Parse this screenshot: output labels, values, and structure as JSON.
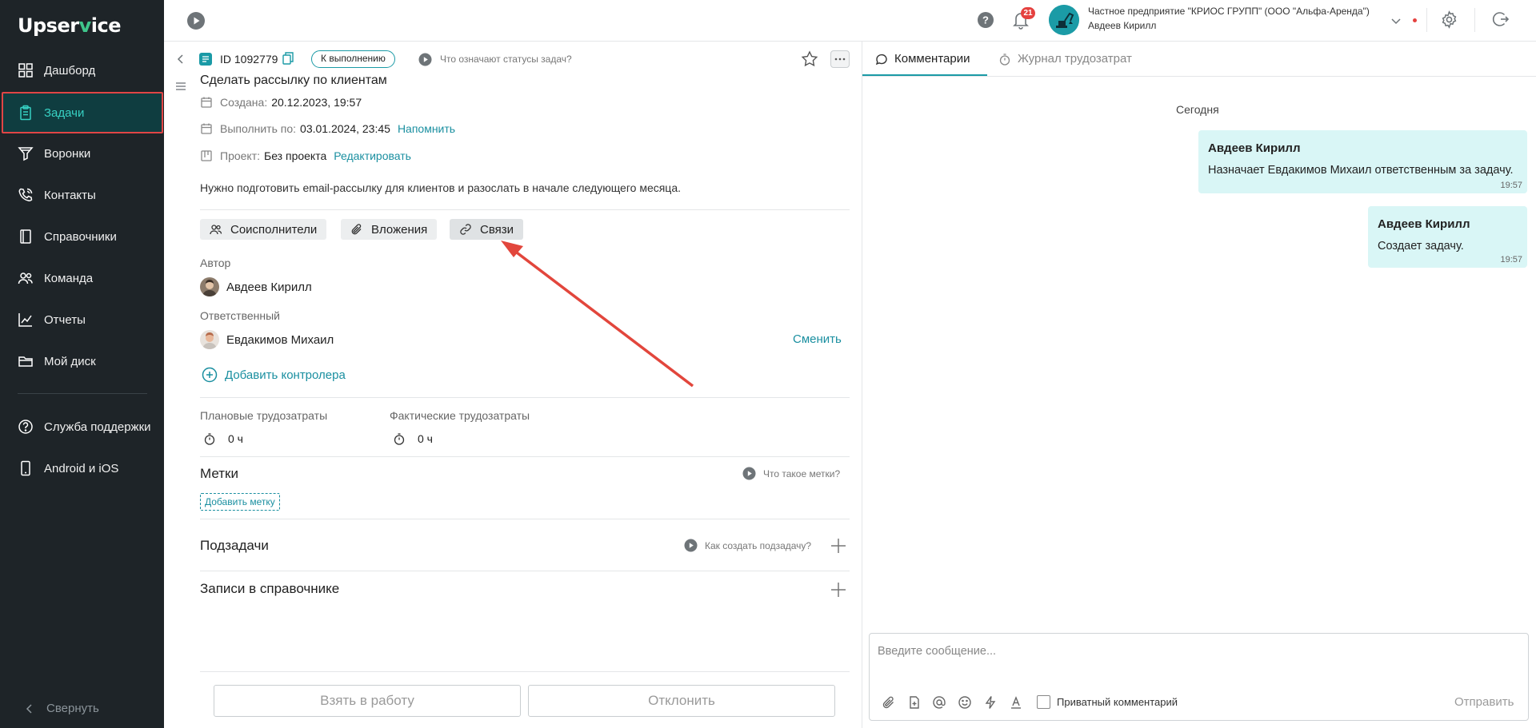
{
  "brand": {
    "logo_pre": "Upser",
    "logo_v": "v",
    "logo_post": "ice"
  },
  "sidebar": {
    "items": [
      {
        "label": "Дашборд"
      },
      {
        "label": "Задачи"
      },
      {
        "label": "Воронки"
      },
      {
        "label": "Контакты"
      },
      {
        "label": "Справочники"
      },
      {
        "label": "Команда"
      },
      {
        "label": "Отчеты"
      },
      {
        "label": "Мой диск"
      },
      {
        "label": "Служба поддержки"
      },
      {
        "label": "Android и iOS"
      }
    ],
    "collapse_label": "Свернуть",
    "accent": "#37d1c3",
    "active_border": "#e04545"
  },
  "topbar": {
    "notifications_count": "21",
    "company": "Частное предприятие \"КРИОС ГРУПП\" (ООО \"Альфа-Аренда\")",
    "user": "Авдеев Кирилл"
  },
  "task": {
    "id": "ID 1092779",
    "status": "К выполнению",
    "status_help": "Что означают статусы задач?",
    "title": "Сделать рассылку по клиентам",
    "created_label": "Создана:",
    "created_value": "20.12.2023, 19:57",
    "due_label": "Выполнить по:",
    "due_value": "03.01.2024, 23:45",
    "remind_link": "Напомнить",
    "project_label": "Проект:",
    "project_value": "Без проекта",
    "edit_link": "Редактировать",
    "description": "Нужно подготовить email-рассылку для клиентов и разослать в начале следующего месяца.",
    "chips": {
      "coexecutors": "Соисполнители",
      "attachments": "Вложения",
      "links": "Связи"
    },
    "author_label": "Автор",
    "author_name": "Авдеев Кирилл",
    "responsible_label": "Ответственный",
    "responsible_name": "Евдакимов Михаил",
    "change_link": "Сменить",
    "add_controller": "Добавить контролера",
    "planned_label": "Плановые трудозатраты",
    "planned_value": "0 ч",
    "actual_label": "Фактические трудозатраты",
    "actual_value": "0 ч",
    "tags_title": "Метки",
    "tags_help": "Что такое метки?",
    "add_tag": "Добавить метку",
    "subtasks_title": "Подзадачи",
    "subtasks_help": "Как создать подзадачу?",
    "records_title": "Записи в справочнике",
    "take_button": "Взять в работу",
    "reject_button": "Отклонить"
  },
  "comments": {
    "tab_comments": "Комментарии",
    "tab_log": "Журнал трудозатрат",
    "day": "Сегодня",
    "messages": [
      {
        "author": "Авдеев Кирилл",
        "text": "Назначает Евдакимов Михаил ответственным за задачу.",
        "time": "19:57"
      },
      {
        "author": "Авдеев Кирилл",
        "text": "Создает задачу.",
        "time": "19:57"
      }
    ],
    "input_placeholder": "Введите сообщение...",
    "private_label": "Приватный комментарий",
    "send_label": "Отправить"
  }
}
